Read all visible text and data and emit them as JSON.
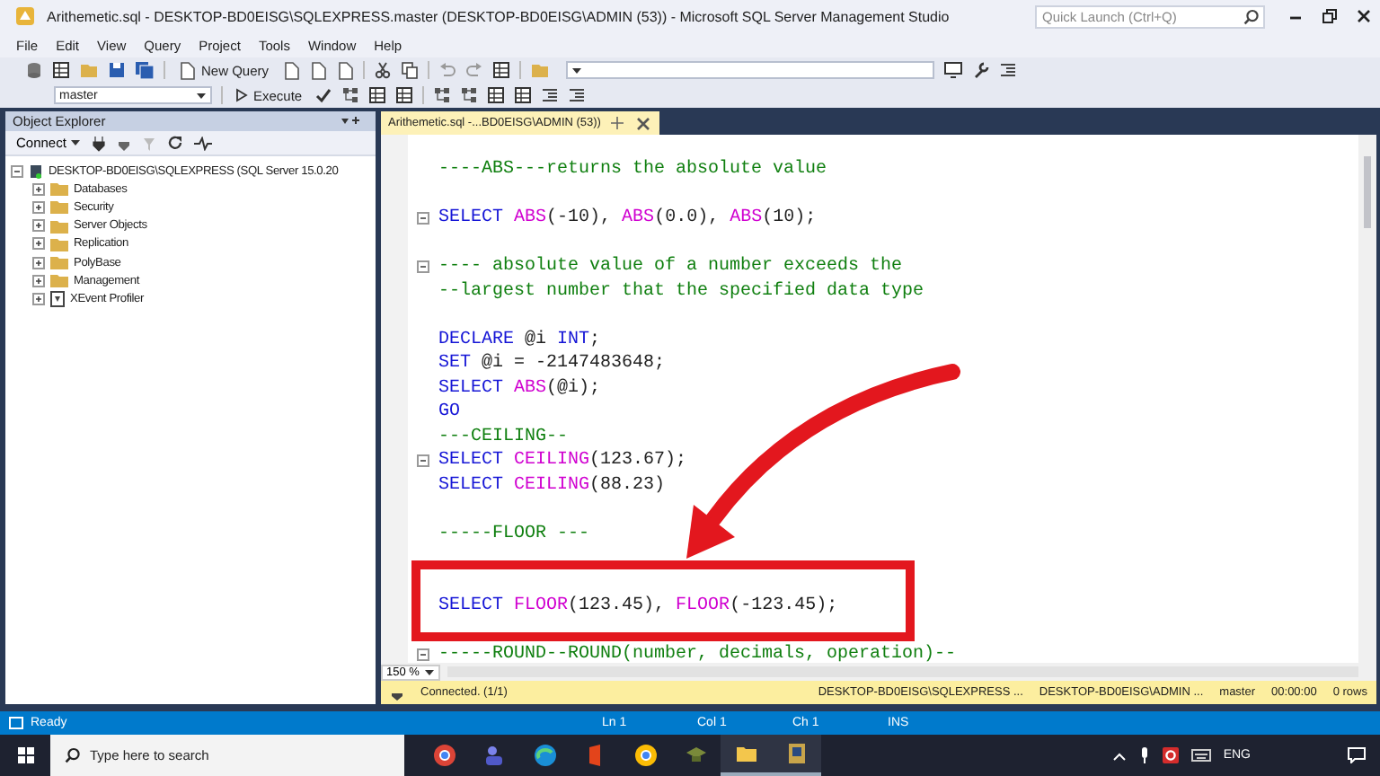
{
  "window": {
    "title": "Arithemetic.sql - DESKTOP-BD0EISG\\SQLEXPRESS.master (DESKTOP-BD0EISG\\ADMIN (53)) - Microsoft SQL Server Management Studio",
    "quick_launch": {
      "placeholder": "Quick Launch (Ctrl+Q)"
    }
  },
  "menu": [
    "File",
    "Edit",
    "View",
    "Query",
    "Project",
    "Tools",
    "Window",
    "Help"
  ],
  "toolbar": {
    "new_query": "New Query",
    "database": "master",
    "execute": "Execute"
  },
  "object_explorer": {
    "title": "Object Explorer",
    "connect": "Connect",
    "tree": [
      {
        "label": "DESKTOP-BD0EISG\\SQLEXPRESS (SQL Server 15.0.20",
        "kind": "server",
        "expanded": true,
        "children": [
          {
            "label": "Databases",
            "kind": "folder",
            "expanded": false
          },
          {
            "label": "Security",
            "kind": "folder",
            "expanded": false
          },
          {
            "label": "Server Objects",
            "kind": "folder",
            "expanded": false
          },
          {
            "label": "Replication",
            "kind": "folder",
            "expanded": false
          },
          {
            "label": "PolyBase",
            "kind": "folder",
            "expanded": false
          },
          {
            "label": "Management",
            "kind": "folder",
            "expanded": false
          },
          {
            "label": "XEvent Profiler",
            "kind": "profiler",
            "expanded": false
          }
        ]
      }
    ]
  },
  "editor": {
    "tab": {
      "label": "Arithemetic.sql -...BD0EISG\\ADMIN (53))",
      "selected": true
    },
    "zoom": "150 %",
    "lines": [
      {
        "collapsible": false,
        "highlighted": false,
        "tokens": [
          {
            "kind": "comment",
            "text": "----ABS---returns the absolute value"
          }
        ]
      },
      {
        "collapsible": false,
        "highlighted": false
      },
      {
        "collapsible": true,
        "highlighted": false,
        "tokens": [
          {
            "kind": "keyword",
            "text": "SELECT "
          },
          {
            "kind": "function",
            "text": "ABS"
          },
          {
            "kind": "plain",
            "text": "(-10), "
          },
          {
            "kind": "function",
            "text": "ABS"
          },
          {
            "kind": "plain",
            "text": "(0.0), "
          },
          {
            "kind": "function",
            "text": "ABS"
          },
          {
            "kind": "plain",
            "text": "(10);"
          }
        ]
      },
      {
        "collapsible": false,
        "highlighted": false
      },
      {
        "collapsible": true,
        "highlighted": false,
        "tokens": [
          {
            "kind": "comment",
            "text": "---- absolute value of a number exceeds the"
          }
        ]
      },
      {
        "collapsible": false,
        "highlighted": false,
        "tokens": [
          {
            "kind": "comment",
            "text": "--largest number that the specified data type"
          }
        ]
      },
      {
        "collapsible": false,
        "highlighted": false
      },
      {
        "collapsible": false,
        "highlighted": false,
        "tokens": [
          {
            "kind": "keyword",
            "text": "DECLARE"
          },
          {
            "kind": "plain",
            "text": " @i "
          },
          {
            "kind": "keyword",
            "text": "INT"
          },
          {
            "kind": "plain",
            "text": ";"
          }
        ]
      },
      {
        "collapsible": false,
        "highlighted": false,
        "tokens": [
          {
            "kind": "keyword",
            "text": "SET"
          },
          {
            "kind": "plain",
            "text": " @i = -2147483648;"
          }
        ]
      },
      {
        "collapsible": false,
        "highlighted": false,
        "tokens": [
          {
            "kind": "keyword",
            "text": "SELECT "
          },
          {
            "kind": "function",
            "text": "ABS"
          },
          {
            "kind": "plain",
            "text": "(@i);"
          }
        ]
      },
      {
        "collapsible": false,
        "highlighted": false,
        "tokens": [
          {
            "kind": "keyword",
            "text": "GO"
          }
        ]
      },
      {
        "collapsible": false,
        "highlighted": false,
        "tokens": [
          {
            "kind": "comment",
            "text": "---CEILING--"
          }
        ]
      },
      {
        "collapsible": true,
        "highlighted": false,
        "tokens": [
          {
            "kind": "keyword",
            "text": "SELECT "
          },
          {
            "kind": "function",
            "text": "CEILING"
          },
          {
            "kind": "plain",
            "text": "(123.67);"
          }
        ]
      },
      {
        "collapsible": false,
        "highlighted": false,
        "tokens": [
          {
            "kind": "keyword",
            "text": "SELECT "
          },
          {
            "kind": "function",
            "text": "CEILING"
          },
          {
            "kind": "plain",
            "text": "(88.23)"
          }
        ]
      },
      {
        "collapsible": false,
        "highlighted": false
      },
      {
        "collapsible": false,
        "highlighted": false,
        "tokens": [
          {
            "kind": "comment",
            "text": "-----FLOOR ---"
          }
        ]
      },
      {
        "collapsible": false,
        "highlighted": false
      },
      {
        "collapsible": false,
        "highlighted": false
      },
      {
        "collapsible": false,
        "highlighted": true,
        "tokens": [
          {
            "kind": "keyword",
            "text": "SELECT "
          },
          {
            "kind": "function",
            "text": "FLOOR"
          },
          {
            "kind": "plain",
            "text": "(123.45), "
          },
          {
            "kind": "function",
            "text": "FLOOR"
          },
          {
            "kind": "plain",
            "text": "(-123.45);"
          }
        ]
      },
      {
        "collapsible": false,
        "highlighted": false
      },
      {
        "collapsible": true,
        "highlighted": false,
        "tokens": [
          {
            "kind": "comment",
            "text": "-----ROUND--ROUND(number, decimals, operation)--"
          }
        ]
      }
    ]
  },
  "query_status": {
    "message": "Connected. (1/1)",
    "server": "DESKTOP-BD0EISG\\SQLEXPRESS ...",
    "user": "DESKTOP-BD0EISG\\ADMIN ...",
    "database": "master",
    "elapsed": "00:00:00",
    "rows": "0 rows"
  },
  "status_bar": {
    "state": "Ready",
    "line": "Ln 1",
    "column": "Col 1",
    "char": "Ch 1",
    "mode": "INS"
  },
  "taskbar": {
    "search": {
      "placeholder": "Type here to search"
    },
    "language": "ENG"
  }
}
